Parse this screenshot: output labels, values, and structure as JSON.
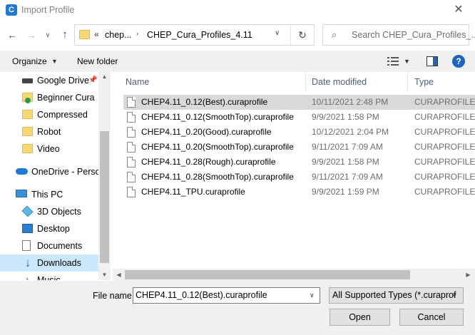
{
  "window": {
    "title": "Import Profile",
    "app_icon_letter": "C",
    "close_glyph": "✕"
  },
  "address": {
    "overflow": "«",
    "crumbs": [
      "chep...",
      "CHEP_Cura_Profiles_4.11"
    ],
    "separator": "›",
    "search_placeholder": "Search CHEP_Cura_Profiles_..."
  },
  "toolbar": {
    "organize_label": "Organize",
    "new_folder_label": "New folder",
    "help_label": "?"
  },
  "nav": {
    "items": [
      {
        "label": "Google Drive",
        "icon": "drive-icon",
        "pinned": true
      },
      {
        "label": "Beginner Cura",
        "icon": "folder-icon"
      },
      {
        "label": "Compressed",
        "icon": "folder-icon"
      },
      {
        "label": "Robot",
        "icon": "folder-icon"
      },
      {
        "label": "Video",
        "icon": "folder-icon"
      },
      {
        "label": "OneDrive - Personal",
        "icon": "onedrive-icon"
      },
      {
        "label": "This PC",
        "icon": "computer-icon"
      },
      {
        "label": "3D Objects",
        "icon": "3d-objects-icon"
      },
      {
        "label": "Desktop",
        "icon": "desktop-icon"
      },
      {
        "label": "Documents",
        "icon": "documents-icon"
      },
      {
        "label": "Downloads",
        "icon": "downloads-icon",
        "selected": true
      },
      {
        "label": "Music",
        "icon": "music-icon"
      }
    ]
  },
  "list": {
    "columns": {
      "name": "Name",
      "date": "Date modified",
      "type": "Type"
    },
    "rows": [
      {
        "name": "CHEP4.11_0.12(Best).curaprofile",
        "date": "10/11/2021 2:48 PM",
        "type": "CURAPROFILE F",
        "selected": true
      },
      {
        "name": "CHEP4.11_0.12(SmoothTop).curaprofile",
        "date": "9/9/2021 1:58 PM",
        "type": "CURAPROFILE F"
      },
      {
        "name": "CHEP4.11_0.20(Good).curaprofile",
        "date": "10/12/2021 2:04 PM",
        "type": "CURAPROFILE F"
      },
      {
        "name": "CHEP4.11_0.20(SmoothTop).curaprofile",
        "date": "9/11/2021 7:09 AM",
        "type": "CURAPROFILE F"
      },
      {
        "name": "CHEP4.11_0.28(Rough).curaprofile",
        "date": "9/9/2021 1:58 PM",
        "type": "CURAPROFILE F"
      },
      {
        "name": "CHEP4.11_0.28(SmoothTop).curaprofile",
        "date": "9/11/2021 7:09 AM",
        "type": "CURAPROFILE F"
      },
      {
        "name": "CHEP4.11_TPU.curaprofile",
        "date": "9/9/2021 1:59 PM",
        "type": "CURAPROFILE F"
      }
    ]
  },
  "footer": {
    "filename_label": "File name:",
    "filename_value": "CHEP4.11_0.12(Best).curaprofile",
    "type_filter": "All Supported Types (*.curaprof",
    "open_label": "Open",
    "cancel_label": "Cancel"
  }
}
